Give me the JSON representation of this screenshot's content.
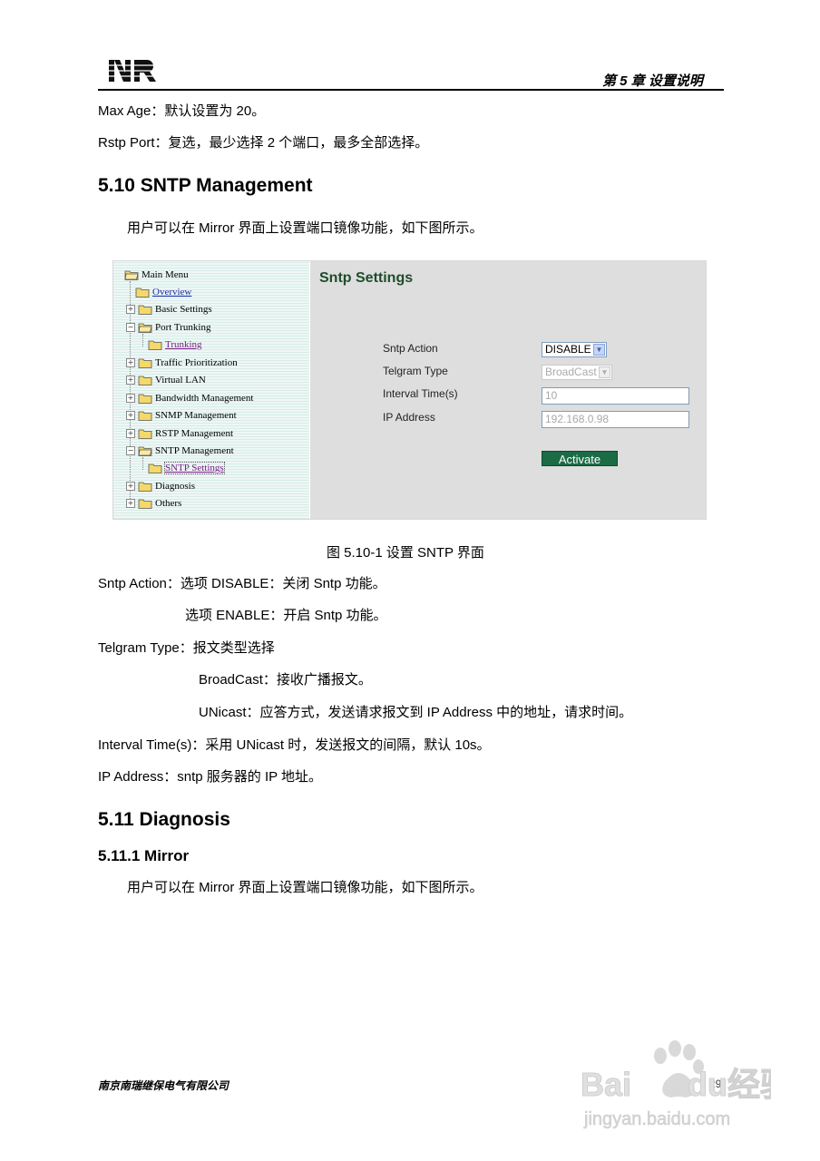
{
  "header": {
    "logo_text": "NR",
    "chapter": "第 5 章  设置说明"
  },
  "intro": {
    "max_age": "Max Age：默认设置为 20。",
    "rstp_port": "Rstp Port：复选，最少选择 2 个端口，最多全部选择。"
  },
  "section_510": {
    "title": "5.10 SNTP Management",
    "intro": "用户可以在 Mirror 界面上设置端口镜像功能，如下图所示。"
  },
  "figure": {
    "tree": [
      {
        "label": "Main Menu",
        "style": "plain"
      },
      {
        "label": "Overview",
        "style": "link"
      },
      {
        "label": "Basic Settings",
        "style": "plain"
      },
      {
        "label": "Port Trunking",
        "style": "plain"
      },
      {
        "label": "Trunking",
        "style": "visited"
      },
      {
        "label": "Traffic Prioritization",
        "style": "plain"
      },
      {
        "label": "Virtual LAN",
        "style": "plain"
      },
      {
        "label": "Bandwidth Management",
        "style": "plain"
      },
      {
        "label": "SNMP Management",
        "style": "plain"
      },
      {
        "label": "RSTP Management",
        "style": "plain"
      },
      {
        "label": "SNTP Management",
        "style": "plain"
      },
      {
        "label": "SNTP Settings",
        "style": "visited"
      },
      {
        "label": "Diagnosis",
        "style": "plain"
      },
      {
        "label": "Others",
        "style": "plain"
      }
    ],
    "panel": {
      "title": "Sntp Settings",
      "sntp_action_label": "Sntp Action",
      "sntp_action_value": "DISABLE",
      "telgram_type_label": "Telgram Type",
      "telgram_type_value": "BroadCast",
      "interval_label": "Interval Time(s)",
      "interval_value": "10",
      "ip_label": "IP Address",
      "ip_value": "192.168.0.98",
      "activate_label": "Activate"
    },
    "colors": {
      "panel_title": "#1e4d2b",
      "activate_bg": "#1b6b45",
      "link": "#1f2fa6",
      "visited": "#7b1f86"
    }
  },
  "caption": "图  5.10-1 设置 SNTP 界面",
  "descriptions": {
    "sntp_action_1": "Sntp Action：选项 DISABLE：关闭 Sntp 功能。",
    "sntp_action_2": "选项 ENABLE：开启 Sntp 功能。",
    "telgram_1": "Telgram Type：报文类型选择",
    "telgram_2": "BroadCast：接收广播报文。",
    "telgram_3": "UNicast：应答方式，发送请求报文到 IP Address 中的地址，请求时间。",
    "interval": "Interval Time(s)：采用 UNicast 时，发送报文的间隔，默认 10s。",
    "ip": "IP Address：sntp 服务器的 IP 地址。"
  },
  "section_511": {
    "title": "5.11 Diagnosis",
    "sub_title": "5.11.1 Mirror",
    "intro": "用户可以在 Mirror 界面上设置端口镜像功能，如下图所示。"
  },
  "footer": {
    "company": "南京南瑞继保电气有限公司",
    "page": "29",
    "watermark_brand": "Baidu经验",
    "watermark_url": "jingyan.baidu.com"
  }
}
